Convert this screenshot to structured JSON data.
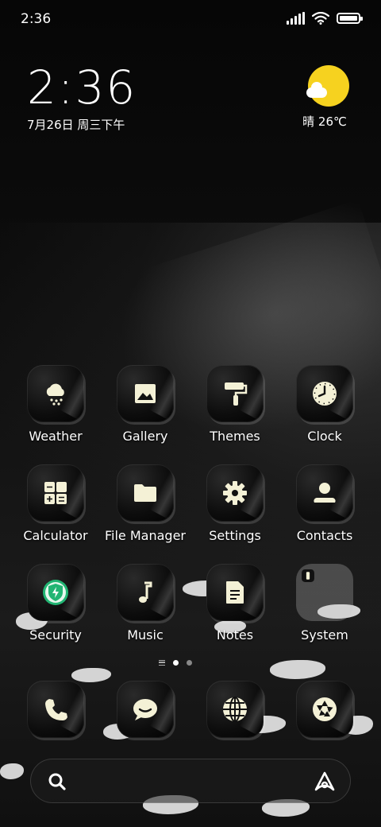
{
  "status_bar": {
    "time": "2:36",
    "battery_percent": 100,
    "icons": [
      "signal-icon",
      "wifi-icon",
      "battery-icon"
    ]
  },
  "clock_widget": {
    "time": "2:36",
    "date": "7月26日 周三下午"
  },
  "weather_widget": {
    "icon": "sun-cloud-icon",
    "summary": "晴 26℃"
  },
  "apps": [
    {
      "label": "Weather",
      "icon": "weather-icon"
    },
    {
      "label": "Gallery",
      "icon": "gallery-icon"
    },
    {
      "label": "Themes",
      "icon": "themes-icon"
    },
    {
      "label": "Clock",
      "icon": "clock-icon"
    },
    {
      "label": "Calculator",
      "icon": "calculator-icon"
    },
    {
      "label": "File Manager",
      "icon": "folder-icon"
    },
    {
      "label": "Settings",
      "icon": "gear-icon"
    },
    {
      "label": "Contacts",
      "icon": "contacts-icon"
    },
    {
      "label": "Security",
      "icon": "security-icon"
    },
    {
      "label": "Music",
      "icon": "music-icon"
    },
    {
      "label": "Notes",
      "icon": "notes-icon"
    },
    {
      "label": "System",
      "icon": "folder-group-icon"
    }
  ],
  "pager": {
    "pages": 2,
    "current": 1
  },
  "dock": [
    {
      "icon": "phone-icon"
    },
    {
      "icon": "messages-icon"
    },
    {
      "icon": "browser-icon"
    },
    {
      "icon": "camera-icon"
    }
  ],
  "search_bar": {
    "left_icon": "search-icon",
    "right_icon": "assistant-icon"
  },
  "colors": {
    "accent_sun": "#f6d21f",
    "icon_glyph": "#f4f1d6",
    "security_green": "#22b573"
  }
}
